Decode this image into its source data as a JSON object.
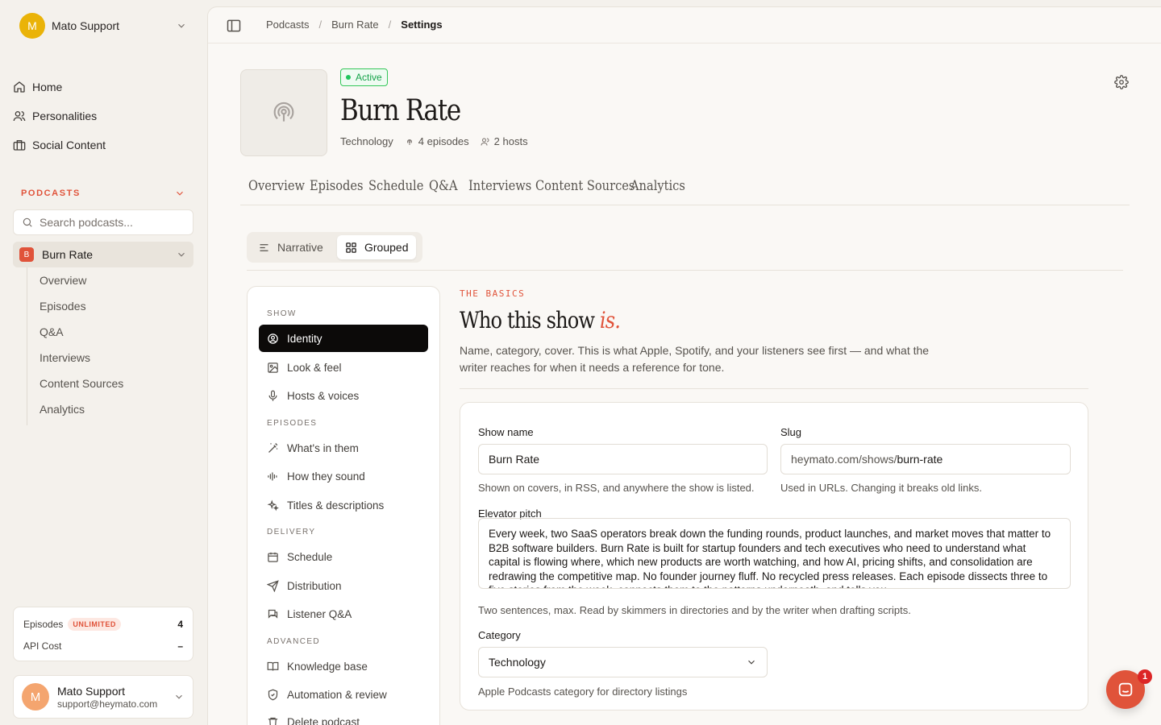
{
  "workspace": {
    "initial": "M",
    "name": "Mato Support"
  },
  "nav": [
    {
      "label": "Home",
      "icon": "home-icon"
    },
    {
      "label": "Personalities",
      "icon": "users-icon"
    },
    {
      "label": "Social Content",
      "icon": "briefcase-icon"
    }
  ],
  "podcasts_section": {
    "label": "PODCASTS",
    "search_placeholder": "Search podcasts..."
  },
  "selected_podcast": {
    "initial": "B",
    "name": "Burn Rate"
  },
  "podcast_subnav": [
    "Overview",
    "Episodes",
    "Q&A",
    "Interviews",
    "Content Sources",
    "Analytics"
  ],
  "usage": {
    "episodes_label": "Episodes",
    "plan_badge": "UNLIMITED",
    "episodes_value": "4",
    "api_cost_label": "API Cost",
    "api_cost_value": "–"
  },
  "user": {
    "initial": "M",
    "name": "Mato Support",
    "email": "support@heymato.com"
  },
  "breadcrumb": {
    "items": [
      "Podcasts",
      "Burn Rate"
    ],
    "current": "Settings",
    "sep": "/"
  },
  "show": {
    "status": "Active",
    "title": "Burn Rate",
    "category": "Technology",
    "episodes": "4 episodes",
    "hosts": "2 hosts"
  },
  "tabs": [
    "Overview",
    "Episodes",
    "Schedule",
    "Q&A",
    "Interviews",
    "Content Sources",
    "Analytics"
  ],
  "view_toggle": {
    "narrative": "Narrative",
    "grouped": "Grouped",
    "active": "Grouped"
  },
  "settings_nav": {
    "sections": [
      {
        "label": "SHOW",
        "items": [
          "Identity",
          "Look & feel",
          "Hosts & voices"
        ]
      },
      {
        "label": "EPISODES",
        "items": [
          "What's in them",
          "How they sound",
          "Titles & descriptions"
        ]
      },
      {
        "label": "DELIVERY",
        "items": [
          "Schedule",
          "Distribution",
          "Listener Q&A"
        ]
      },
      {
        "label": "ADVANCED",
        "items": [
          "Knowledge base",
          "Automation & review",
          "Delete podcast"
        ]
      }
    ],
    "active": "Identity"
  },
  "section": {
    "eyebrow": "THE BASICS",
    "heading_main": "Who this show ",
    "heading_accent": "is.",
    "description": "Name, category, cover. This is what Apple, Spotify, and your listeners see first — and what the writer reaches for when it needs a reference for tone."
  },
  "form": {
    "show_name": {
      "label": "Show name",
      "value": "Burn Rate",
      "help": "Shown on covers, in RSS, and anywhere the show is listed."
    },
    "slug": {
      "label": "Slug",
      "prefix": "heymato.com/shows/",
      "value": "burn-rate",
      "help": "Used in URLs. Changing it breaks old links."
    },
    "pitch": {
      "label": "Elevator pitch",
      "value": "Every week, two SaaS operators break down the funding rounds, product launches, and market moves that matter to B2B software builders. Burn Rate is built for startup founders and tech executives who need to understand what capital is flowing where, which new products are worth watching, and how AI, pricing shifts, and consolidation are redrawing the competitive map. No founder journey fluff. No recycled press releases. Each episode dissects three to five stories from the week, connects them to the patterns underneath, and tells you",
      "help": "Two sentences, max. Read by skimmers in directories and by the writer when drafting scripts."
    },
    "category": {
      "label": "Category",
      "value": "Technology",
      "help": "Apple Podcasts category for directory listings"
    }
  },
  "chat": {
    "badge": "1"
  },
  "colors": {
    "accent": "#e0533a",
    "active_green": "#16a34a",
    "workspace_avatar": "#eab308"
  }
}
